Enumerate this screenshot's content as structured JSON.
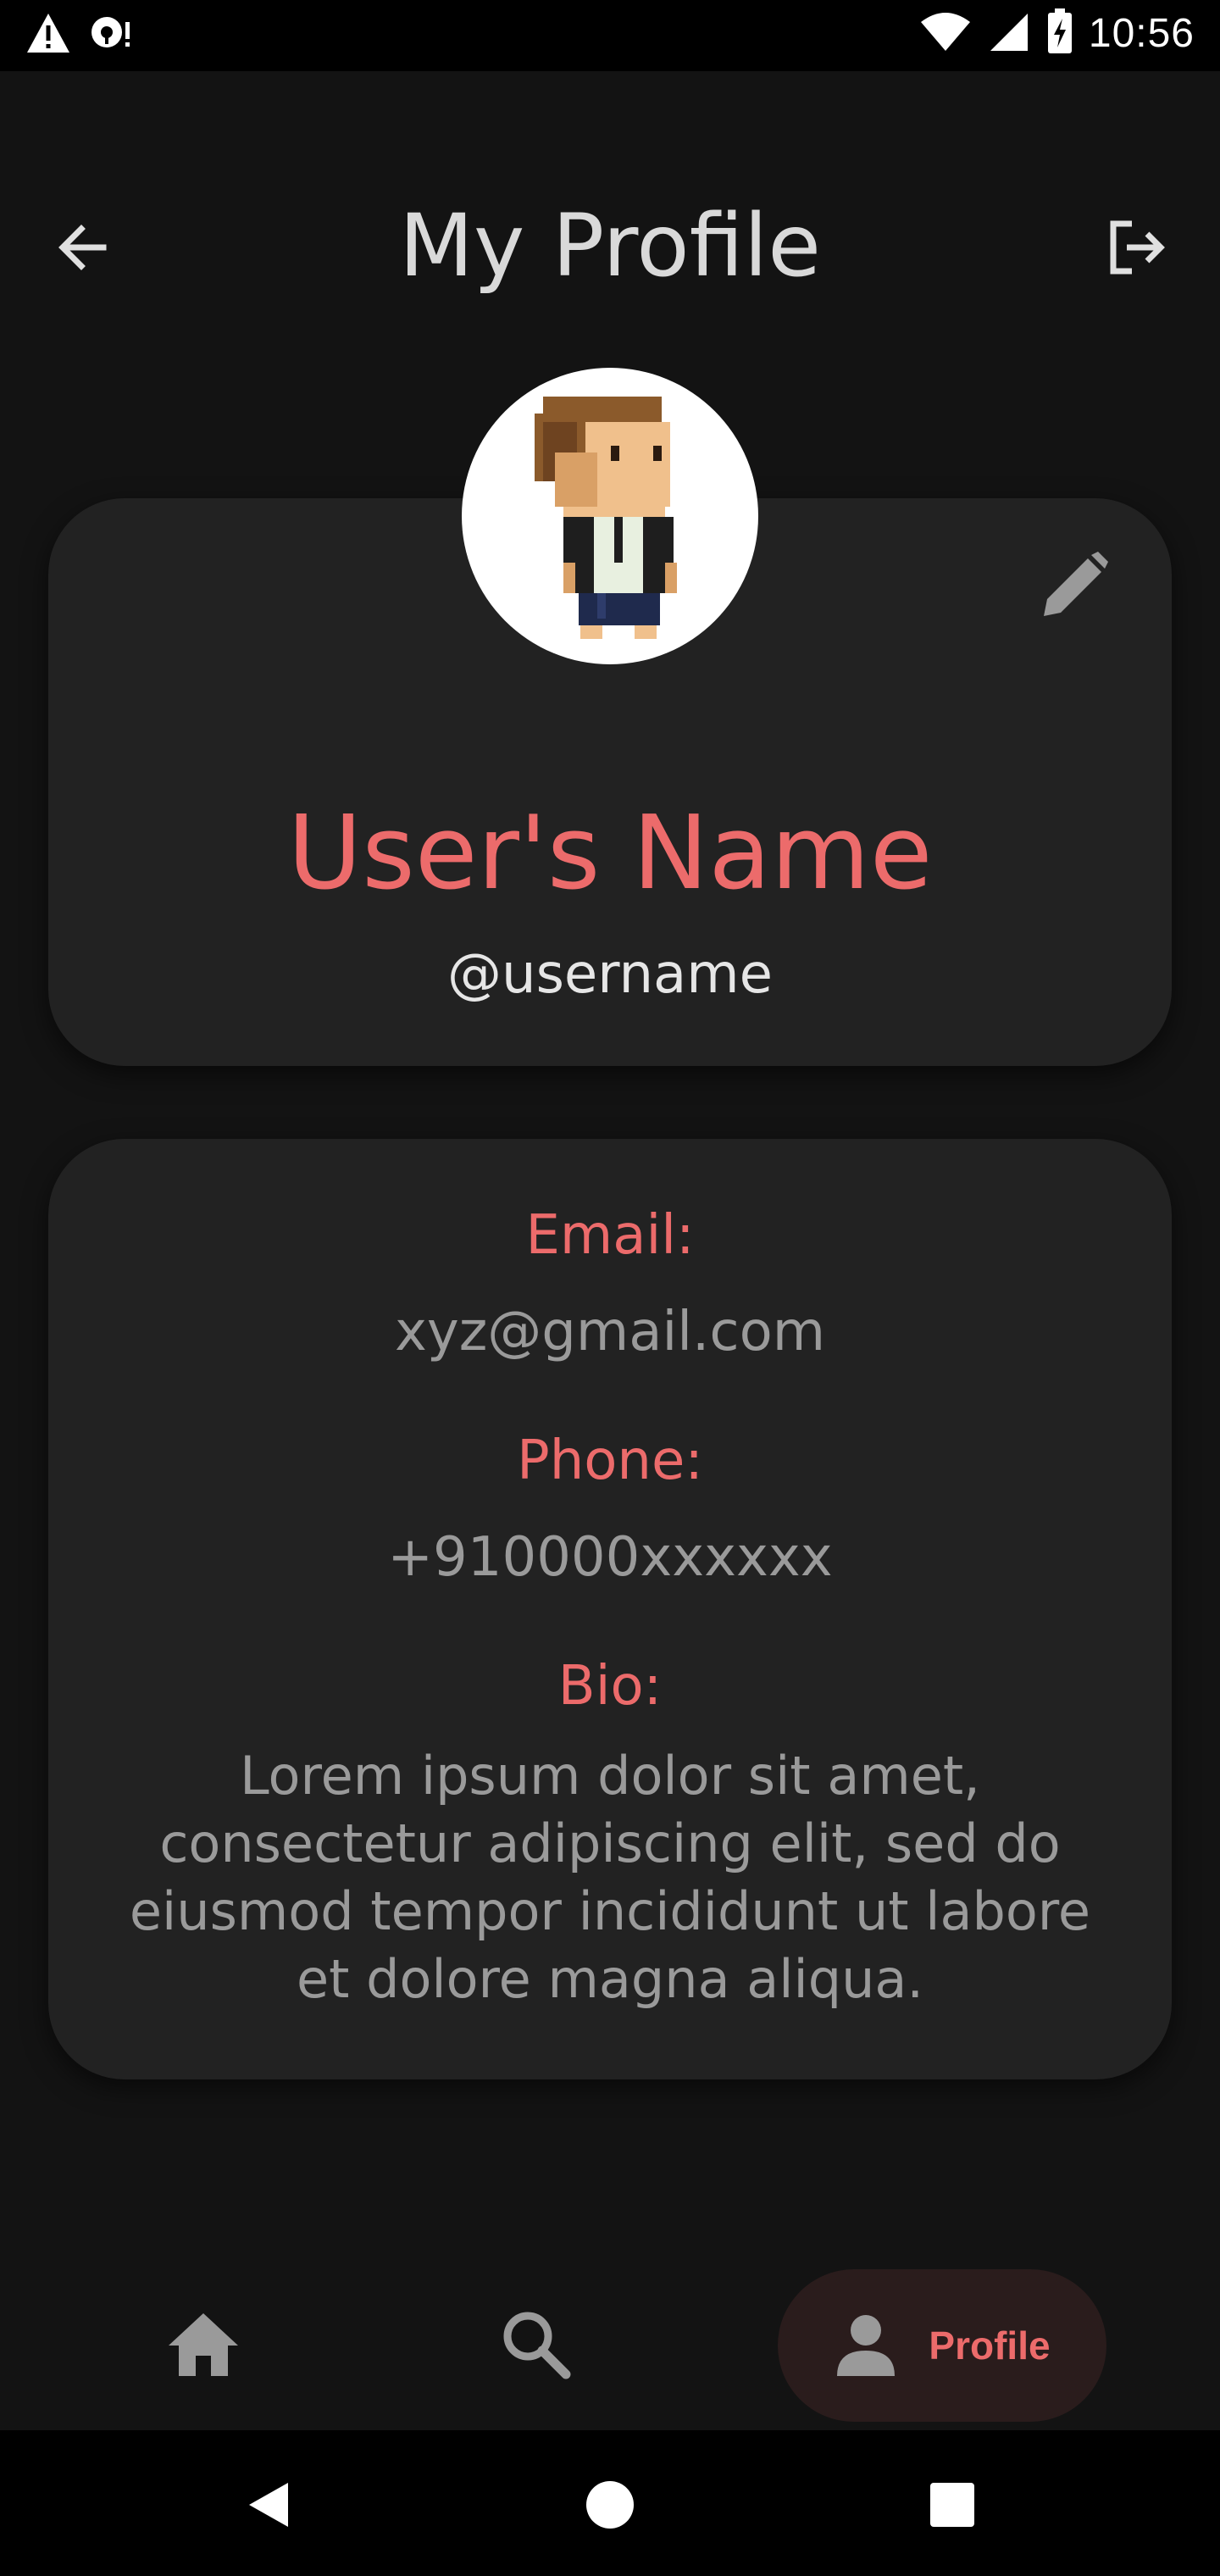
{
  "status_bar": {
    "time": "10:56",
    "icons": [
      "warning-icon",
      "podcast-icon",
      "wifi-icon",
      "signal-icon",
      "battery-charging-icon"
    ]
  },
  "app_bar": {
    "title": "My Profile",
    "back_icon": "arrow-left-icon",
    "logout_icon": "logout-icon"
  },
  "profile": {
    "name": "User's Name",
    "username": "@username",
    "avatar_icon": "pixel-avatar",
    "edit_icon": "pencil-icon"
  },
  "info": {
    "email_label": "Email:",
    "email": "xyz@gmail.com",
    "phone_label": "Phone:",
    "phone": "+910000xxxxxx",
    "bio_label": "Bio:",
    "bio": "Lorem ipsum dolor sit amet, consectetur adipiscing elit, sed do eiusmod tempor incididunt ut labore et dolore magna aliqua."
  },
  "bottom_nav": {
    "items": [
      {
        "icon": "home-icon",
        "label": ""
      },
      {
        "icon": "search-icon",
        "label": ""
      },
      {
        "icon": "person-icon",
        "label": "Profile",
        "active": true
      }
    ]
  },
  "colors": {
    "accent": "#ec6b6b",
    "background": "#131313",
    "card": "#222222"
  }
}
